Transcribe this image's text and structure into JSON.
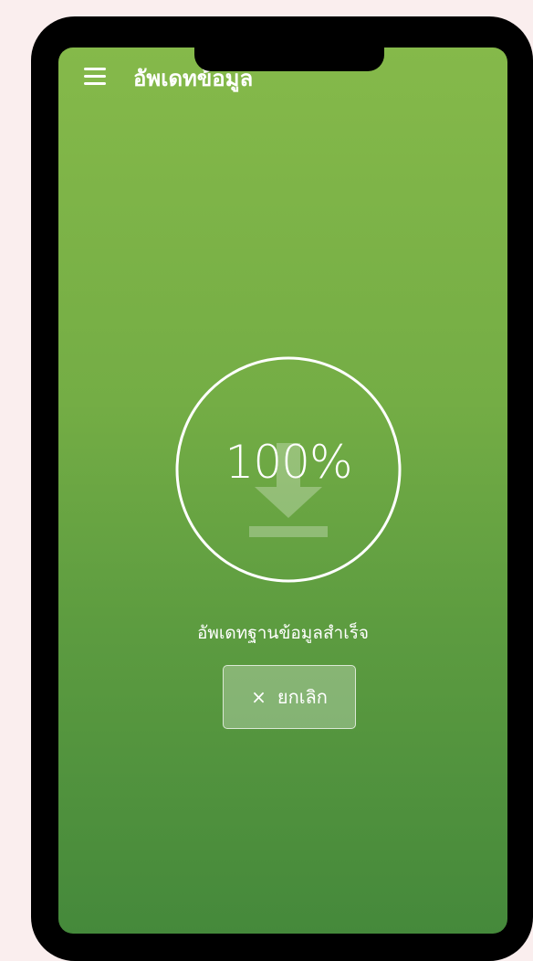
{
  "header": {
    "title": "อัพเดทข้อมูล",
    "menu_icon": "hamburger-menu-icon"
  },
  "progress": {
    "percent_label": "100%",
    "value": 1.0,
    "icon": "download-arrow-icon"
  },
  "status": {
    "text": "อัพเดทฐานข้อมูลสำเร็จ"
  },
  "actions": {
    "cancel_label": "ยกเลิก",
    "cancel_icon": "close-icon"
  },
  "colors": {
    "gradient_top": "#85b94a",
    "gradient_bottom": "#45893b",
    "foreground": "#ffffff",
    "page_background": "#faeeee",
    "device_frame": "#000000"
  }
}
